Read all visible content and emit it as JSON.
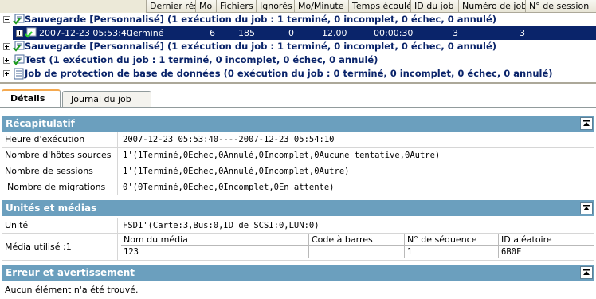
{
  "columns": [
    "Dernier résultat",
    "Mo",
    "Fichiers",
    "Ignorés",
    "Mo/Minute",
    "Temps écoulé",
    "ID du job",
    "Numéro de job",
    "N° de session"
  ],
  "jobs": [
    {
      "label": "Sauvegarde [Personnalisé] (1 exécution du job : 1 terminé, 0 incomplet, 0 échec, 0 annulé)",
      "expanded": true
    },
    {
      "label": "Sauvegarde [Personnalisé] (1 exécution du job : 1 terminé, 0 incomplet, 0 échec, 0 annulé)",
      "expanded": false
    },
    {
      "label": "Test (1 exécution du job : 1 terminé, 0 incomplet, 0 échec, 0 annulé)",
      "expanded": false
    },
    {
      "label": "Job de protection de base de données (0 exécution du job : 0 terminé, 0 incomplet, 0 échec, 0 annulé)",
      "expanded": false
    }
  ],
  "selected_run": {
    "date": "2007-12-23 05:53:40",
    "result": "Terminé",
    "mo": "6",
    "files": "185",
    "ignored": "0",
    "mo_per_min": "12.00",
    "elapsed": "00:00:30",
    "job_id": "3",
    "job_number": "3"
  },
  "tabs": [
    "Détails",
    "Journal du job"
  ],
  "summary": {
    "title": "Récapitulatif",
    "rows": [
      {
        "key": "Heure d'exécution",
        "value": "2007-12-23 05:53:40----2007-12-23 05:54:10"
      },
      {
        "key": "Nombre d'hôtes sources",
        "value": "1'(1Terminé,0Echec,0Annulé,0Incomplet,0Aucune tentative,0Autre)"
      },
      {
        "key": "Nombre de sessions",
        "value": "1'(1Terminé,0Echec,0Annulé,0Incomplet,0Autre)"
      },
      {
        "key": "'Nombre de migrations",
        "value": "0'(0Terminé,0Echec,0Incomplet,0En attente)"
      }
    ]
  },
  "media": {
    "title": "Unités et médias",
    "unit_key": "Unité",
    "unit_value": "FSD1'(Carte:3,Bus:0,ID de SCSI:0,LUN:0)",
    "used_key": "Média utilisé :1",
    "table_headers": [
      "Nom du média",
      "Code à barres",
      "N° de séquence",
      "ID aléatoire"
    ],
    "table_row": [
      "123",
      "",
      "1",
      "6B0F"
    ]
  },
  "errors": {
    "title": "Erreur et avertissement",
    "empty_text": "Aucun élément n'a été trouvé."
  },
  "colors": {
    "section_header": "#6b9fbe",
    "selection": "#0a246a"
  }
}
